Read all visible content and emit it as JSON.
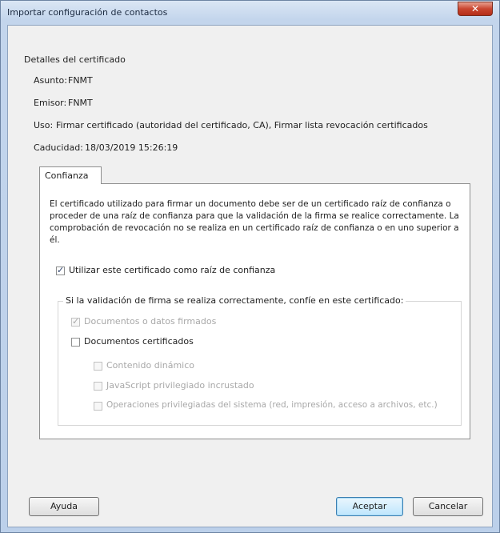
{
  "window": {
    "title": "Importar configuración de contactos",
    "close_glyph": "✕"
  },
  "details": {
    "heading": "Detalles del certificado",
    "subject_label": "Asunto:",
    "subject_value": "FNMT",
    "issuer_label": "Emisor:",
    "issuer_value": "FNMT",
    "usage_label": "Uso:",
    "usage_value": "Firmar certificado (autoridad del certificado, CA), Firmar lista revocación certificados",
    "expiry_label": "Caducidad:",
    "expiry_value": "18/03/2019 15:26:19"
  },
  "tabs": [
    {
      "label": "Confianza",
      "selected": true
    }
  ],
  "trust": {
    "description": "El certificado utilizado para firmar un documento debe ser de un certificado raíz de confianza o proceder de una raíz de confianza para que la validación de la firma se realice correctamente. La comprobación de revocación no se realiza en un certificado raíz de confianza o en uno superior a él.",
    "use_as_root": {
      "label": "Utilizar este certificado como raíz de confianza",
      "checked": true
    },
    "group_legend": "Si la validación de firma se realiza correctamente, confíe en este certificado:",
    "signed_documents": {
      "label": "Documentos o datos firmados",
      "checked": true,
      "enabled": false
    },
    "certified_documents": {
      "label": "Documentos certificados",
      "checked": false,
      "enabled": true
    },
    "dynamic_content": {
      "label": "Contenido dinámico",
      "checked": false,
      "enabled": false
    },
    "embedded_javascript": {
      "label": "JavaScript privilegiado incrustado",
      "checked": false,
      "enabled": false
    },
    "system_operations": {
      "label": "Operaciones privilegiadas del sistema (red, impresión, acceso a archivos, etc.)",
      "checked": false,
      "enabled": false
    }
  },
  "buttons": {
    "help": "Ayuda",
    "accept": "Aceptar",
    "cancel": "Cancelar"
  },
  "colors": {
    "window_frame": "#bcd0ea",
    "client_bg": "#f0f0f0",
    "close_button": "#c9452f",
    "default_button": "#bee6fd"
  }
}
